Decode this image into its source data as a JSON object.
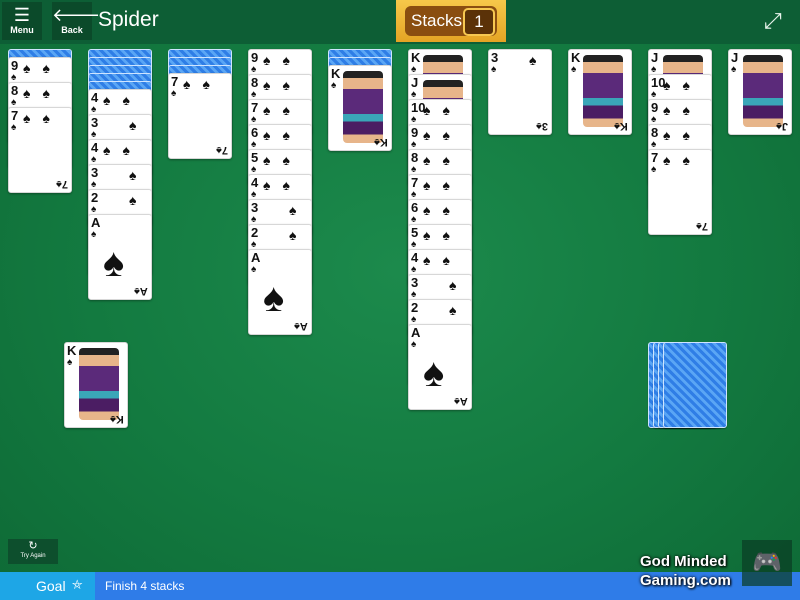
{
  "topbar": {
    "menu": {
      "icon": "hamburger-icon",
      "label": "Menu"
    },
    "back": {
      "icon": "back-arrow-icon",
      "label": "Back"
    },
    "title": "Spider",
    "stacks": {
      "label": "Stacks",
      "count": "1"
    },
    "expand_icon": "expand-icon"
  },
  "suit_symbol": "♠",
  "tableau": [
    {
      "facedown": 1,
      "faceup": [
        "9",
        "8",
        "7"
      ]
    },
    {
      "facedown": 5,
      "faceup": [
        "4",
        "3",
        "4",
        "3",
        "2",
        "A"
      ]
    },
    {
      "facedown": 3,
      "faceup": [
        "7"
      ]
    },
    {
      "facedown": 0,
      "faceup": [
        "9",
        "8",
        "7",
        "6",
        "5",
        "4",
        "3",
        "2",
        "A"
      ]
    },
    {
      "facedown": 2,
      "faceup": [
        "K"
      ]
    },
    {
      "facedown": 0,
      "faceup": [
        "K",
        "J",
        "10",
        "9",
        "8",
        "7",
        "6",
        "5",
        "4",
        "3",
        "2",
        "A"
      ]
    },
    {
      "facedown": 0,
      "faceup": [
        "3"
      ]
    },
    {
      "facedown": 0,
      "faceup": [
        "K"
      ]
    },
    {
      "facedown": 0,
      "faceup": [
        "J",
        "10",
        "9",
        "8",
        "7"
      ]
    },
    {
      "facedown": 0,
      "faceup": [
        "J"
      ]
    }
  ],
  "completed_stack": {
    "top_card": "K"
  },
  "stock": {
    "piles": 4
  },
  "try_again": {
    "icon": "refresh-icon",
    "label": "Try Again"
  },
  "goal": {
    "label": "Goal",
    "icon": "goal-badge-icon",
    "text": "Finish 4 stacks"
  },
  "watermark": {
    "line1": "God Minded",
    "line2": "Gaming.com"
  },
  "colors": {
    "felt": "#137a40",
    "topbar": "#0d5e35",
    "stacks_gold": "#e4a424",
    "goal_bar": "#2f7ce8",
    "goal_left": "#1ea6e6",
    "card_back": "#2f7ee6"
  }
}
